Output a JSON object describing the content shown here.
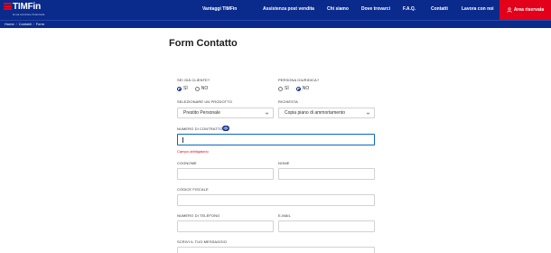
{
  "brand": {
    "name": "TIMFin",
    "tagline": "la tua soluzione finanziaria",
    "colors": {
      "primary": "#0a2a8c",
      "accent": "#e2001a"
    }
  },
  "nav": {
    "items": [
      {
        "label": "Vantaggi TIMFin"
      },
      {
        "label": "Assistenza post vendita"
      },
      {
        "label": "Chi siamo"
      },
      {
        "label": "Dove trovarci"
      },
      {
        "label": "F.A.Q."
      },
      {
        "label": "Contatti"
      },
      {
        "label": "Lavora con noi"
      }
    ],
    "area_label": "Area riservata",
    "area_icon": "user-icon"
  },
  "breadcrumb": [
    "Home",
    "Contatti",
    "Form"
  ],
  "form": {
    "title": "Form Contatto",
    "cliente": {
      "label": "SEI GIÀ CLIENTE?",
      "options": [
        "SÌ",
        "NO"
      ],
      "selected": "SÌ"
    },
    "giuridica": {
      "label": "PERSONA GIURIDICA?",
      "options": [
        "SÌ",
        "NO"
      ],
      "selected": "NO"
    },
    "prodotto": {
      "label": "SELEZIONARE UN PRODOTTO",
      "value": "Prestito Personale"
    },
    "richiesta": {
      "label": "RICHIESTA",
      "value": "Copia piano di ammortamento"
    },
    "contratto": {
      "label": "NUMERO DI CONTRATTO",
      "value": "",
      "error": "Campo obbligatorio"
    },
    "cognome": {
      "label": "COGNOME",
      "value": ""
    },
    "nome": {
      "label": "NOME",
      "value": ""
    },
    "codice_fiscale": {
      "label": "CODICE FISCALE",
      "value": ""
    },
    "telefono": {
      "label": "NUMERO DI TELEFONO",
      "value": ""
    },
    "email": {
      "label": "E-MAIL",
      "value": ""
    },
    "messaggio": {
      "label": "SCRIVI IL TUO MESSAGGIO"
    }
  }
}
